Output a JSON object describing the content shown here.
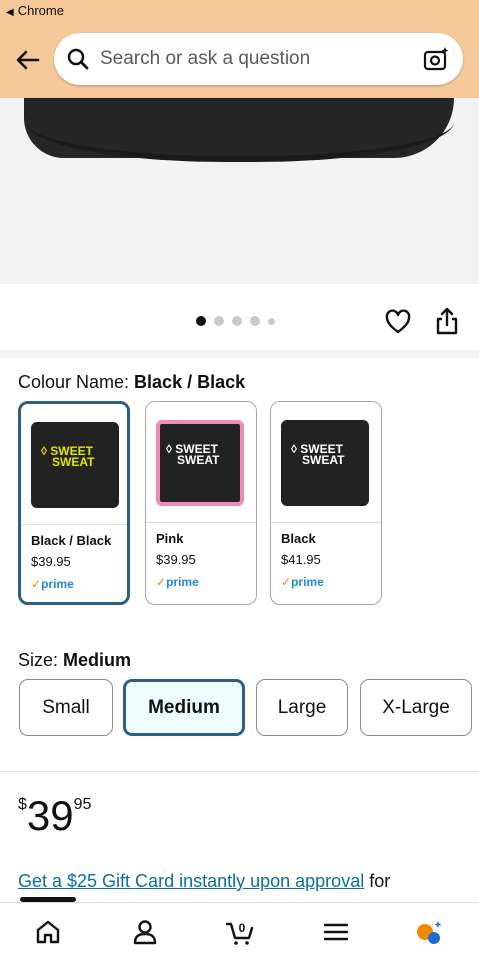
{
  "status": {
    "app_back_label": "Chrome"
  },
  "search": {
    "placeholder": "Search or ask a question"
  },
  "carousel": {
    "dot_count": 5,
    "active_index": 0
  },
  "colour": {
    "label": "Colour Name: ",
    "selected": "Black / Black",
    "options": [
      {
        "name": "Black / Black",
        "price": "$39.95",
        "prime": "prime",
        "band_color": "#222222",
        "trim_color": "#222222",
        "logo_color": "#e2e600"
      },
      {
        "name": "Pink",
        "price": "$39.95",
        "prime": "prime",
        "band_color": "#222222",
        "trim_color": "#f08bb8",
        "logo_color": "#ffffff"
      },
      {
        "name": "Black",
        "price": "$41.95",
        "prime": "prime",
        "band_color": "#222222",
        "trim_color": "#222222",
        "logo_color": "#ffffff"
      }
    ],
    "logo_text_1": "SWEET",
    "logo_text_2": "SWEAT"
  },
  "size": {
    "label": "Size: ",
    "selected": "Medium",
    "options": [
      "Small",
      "Medium",
      "Large",
      "X-Large"
    ]
  },
  "price": {
    "currency": "$",
    "whole": "39",
    "fraction": "95"
  },
  "promo": {
    "link_text": "Get a $25 Gift Card instantly upon approval",
    "trailing_text": " for"
  },
  "colors": {
    "header_bg": "#f5c89a",
    "selected_border": "#2c5e88",
    "link": "#0a6f9f",
    "prime_blue": "#1f8bd1",
    "prime_check": "#f08804"
  }
}
